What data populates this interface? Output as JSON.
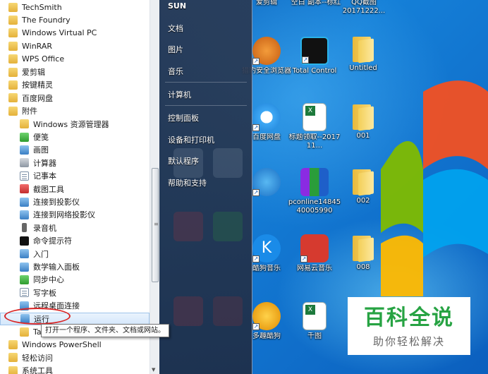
{
  "programs": {
    "items": [
      {
        "label": "TechSmith",
        "icon": "folder-icon",
        "level": 0
      },
      {
        "label": "The Foundry",
        "icon": "folder-icon",
        "level": 0
      },
      {
        "label": "Windows Virtual PC",
        "icon": "folder-icon",
        "level": 0
      },
      {
        "label": "WinRAR",
        "icon": "folder-icon",
        "level": 0
      },
      {
        "label": "WPS Office",
        "icon": "folder-icon",
        "level": 0
      },
      {
        "label": "爱剪辑",
        "icon": "folder-icon",
        "level": 0
      },
      {
        "label": "按键精灵",
        "icon": "folder-icon",
        "level": 0
      },
      {
        "label": "百度网盘",
        "icon": "folder-icon",
        "level": 0
      },
      {
        "label": "附件",
        "icon": "folder-icon",
        "level": 0
      },
      {
        "label": "Windows 资源管理器",
        "icon": "explorer-icon",
        "level": 1
      },
      {
        "label": "便笺",
        "icon": "sticky-notes-icon",
        "level": 1
      },
      {
        "label": "画图",
        "icon": "paint-icon",
        "level": 1
      },
      {
        "label": "计算器",
        "icon": "calculator-icon",
        "level": 1
      },
      {
        "label": "记事本",
        "icon": "notepad-icon",
        "level": 1
      },
      {
        "label": "截图工具",
        "icon": "snipping-tool-icon",
        "level": 1
      },
      {
        "label": "连接到投影仪",
        "icon": "projector-icon",
        "level": 1
      },
      {
        "label": "连接到网络投影仪",
        "icon": "network-projector-icon",
        "level": 1
      },
      {
        "label": "录音机",
        "icon": "microphone-icon",
        "level": 1
      },
      {
        "label": "命令提示符",
        "icon": "command-prompt-icon",
        "level": 1
      },
      {
        "label": "入门",
        "icon": "getting-started-icon",
        "level": 1
      },
      {
        "label": "数学输入面板",
        "icon": "math-input-icon",
        "level": 1
      },
      {
        "label": "同步中心",
        "icon": "sync-center-icon",
        "level": 1
      },
      {
        "label": "写字板",
        "icon": "wordpad-icon",
        "level": 1
      },
      {
        "label": "远程桌面连接",
        "icon": "remote-desktop-icon",
        "level": 1
      },
      {
        "label": "运行",
        "icon": "run-icon",
        "level": 1
      },
      {
        "label": "Ta",
        "icon": "folder-icon",
        "level": 1
      },
      {
        "label": "Windows PowerShell",
        "icon": "folder-icon",
        "level": 0
      },
      {
        "label": "轻松访问",
        "icon": "folder-icon",
        "level": 0
      },
      {
        "label": "系统工具",
        "icon": "folder-icon",
        "level": 0
      }
    ],
    "tooltip": "打开一个程序、文件夹、文档或网站。"
  },
  "right_pane": {
    "links": [
      "SUN",
      "文档",
      "图片",
      "音乐",
      "计算机",
      "控制面板",
      "设备和打印机",
      "默认程序",
      "帮助和支持"
    ]
  },
  "desktop": {
    "top_labels": [
      "爱剪辑",
      "空白 副本--标红",
      "QQ截图20171222..."
    ],
    "icons": [
      {
        "label": "猎豹安全浏览器",
        "icon": "cheetah-browser-icon"
      },
      {
        "label": "Total Control",
        "icon": "total-control-icon"
      },
      {
        "label": "Untitled",
        "icon": "folder-icon"
      },
      {
        "label": "百度网盘",
        "icon": "baidu-netdisk-icon"
      },
      {
        "label": "标题领取--2017 11...",
        "icon": "excel-file-icon"
      },
      {
        "label": "001",
        "icon": "folder-icon"
      },
      {
        "label": "pconline1484540005990",
        "icon": "winrar-archive-icon"
      },
      {
        "label": "002",
        "icon": "folder-icon"
      },
      {
        "label": "酷狗音乐",
        "icon": "kugou-icon"
      },
      {
        "label": "网易云音乐",
        "icon": "netease-music-icon"
      },
      {
        "label": "008",
        "icon": "folder-icon"
      },
      {
        "label": "多趣酷狗",
        "icon": "game-icon"
      },
      {
        "label": "千图",
        "icon": "excel-file-icon"
      }
    ]
  },
  "watermark": {
    "title": "百科全说",
    "subtitle": "助你轻松解决"
  },
  "colors": {
    "accent": "#27a343",
    "highlight": "#d92626",
    "menu_dark": "#2a3a54"
  }
}
